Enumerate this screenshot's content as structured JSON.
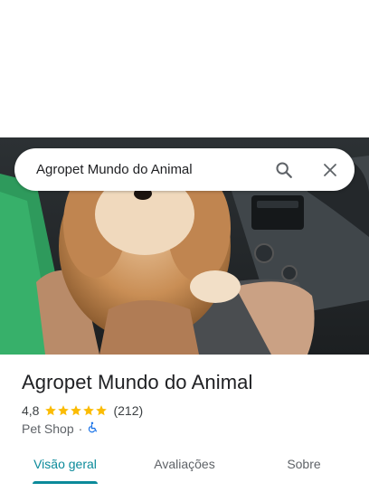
{
  "search": {
    "query": "Agropet Mundo do Animal"
  },
  "place": {
    "name": "Agropet Mundo do Animal",
    "rating": "4,8",
    "stars": 5,
    "review_count": "(212)",
    "category": "Pet Shop",
    "separator": "·"
  },
  "tabs": [
    {
      "label": "Visão geral"
    },
    {
      "label": "Avaliações"
    },
    {
      "label": "Sobre"
    }
  ],
  "colors": {
    "accent": "#0b8a9a",
    "star": "#fbbc04",
    "accessibility": "#1a73e8"
  },
  "icons": {
    "search": "search-icon",
    "close": "close-icon",
    "accessibility": "wheelchair-icon"
  }
}
